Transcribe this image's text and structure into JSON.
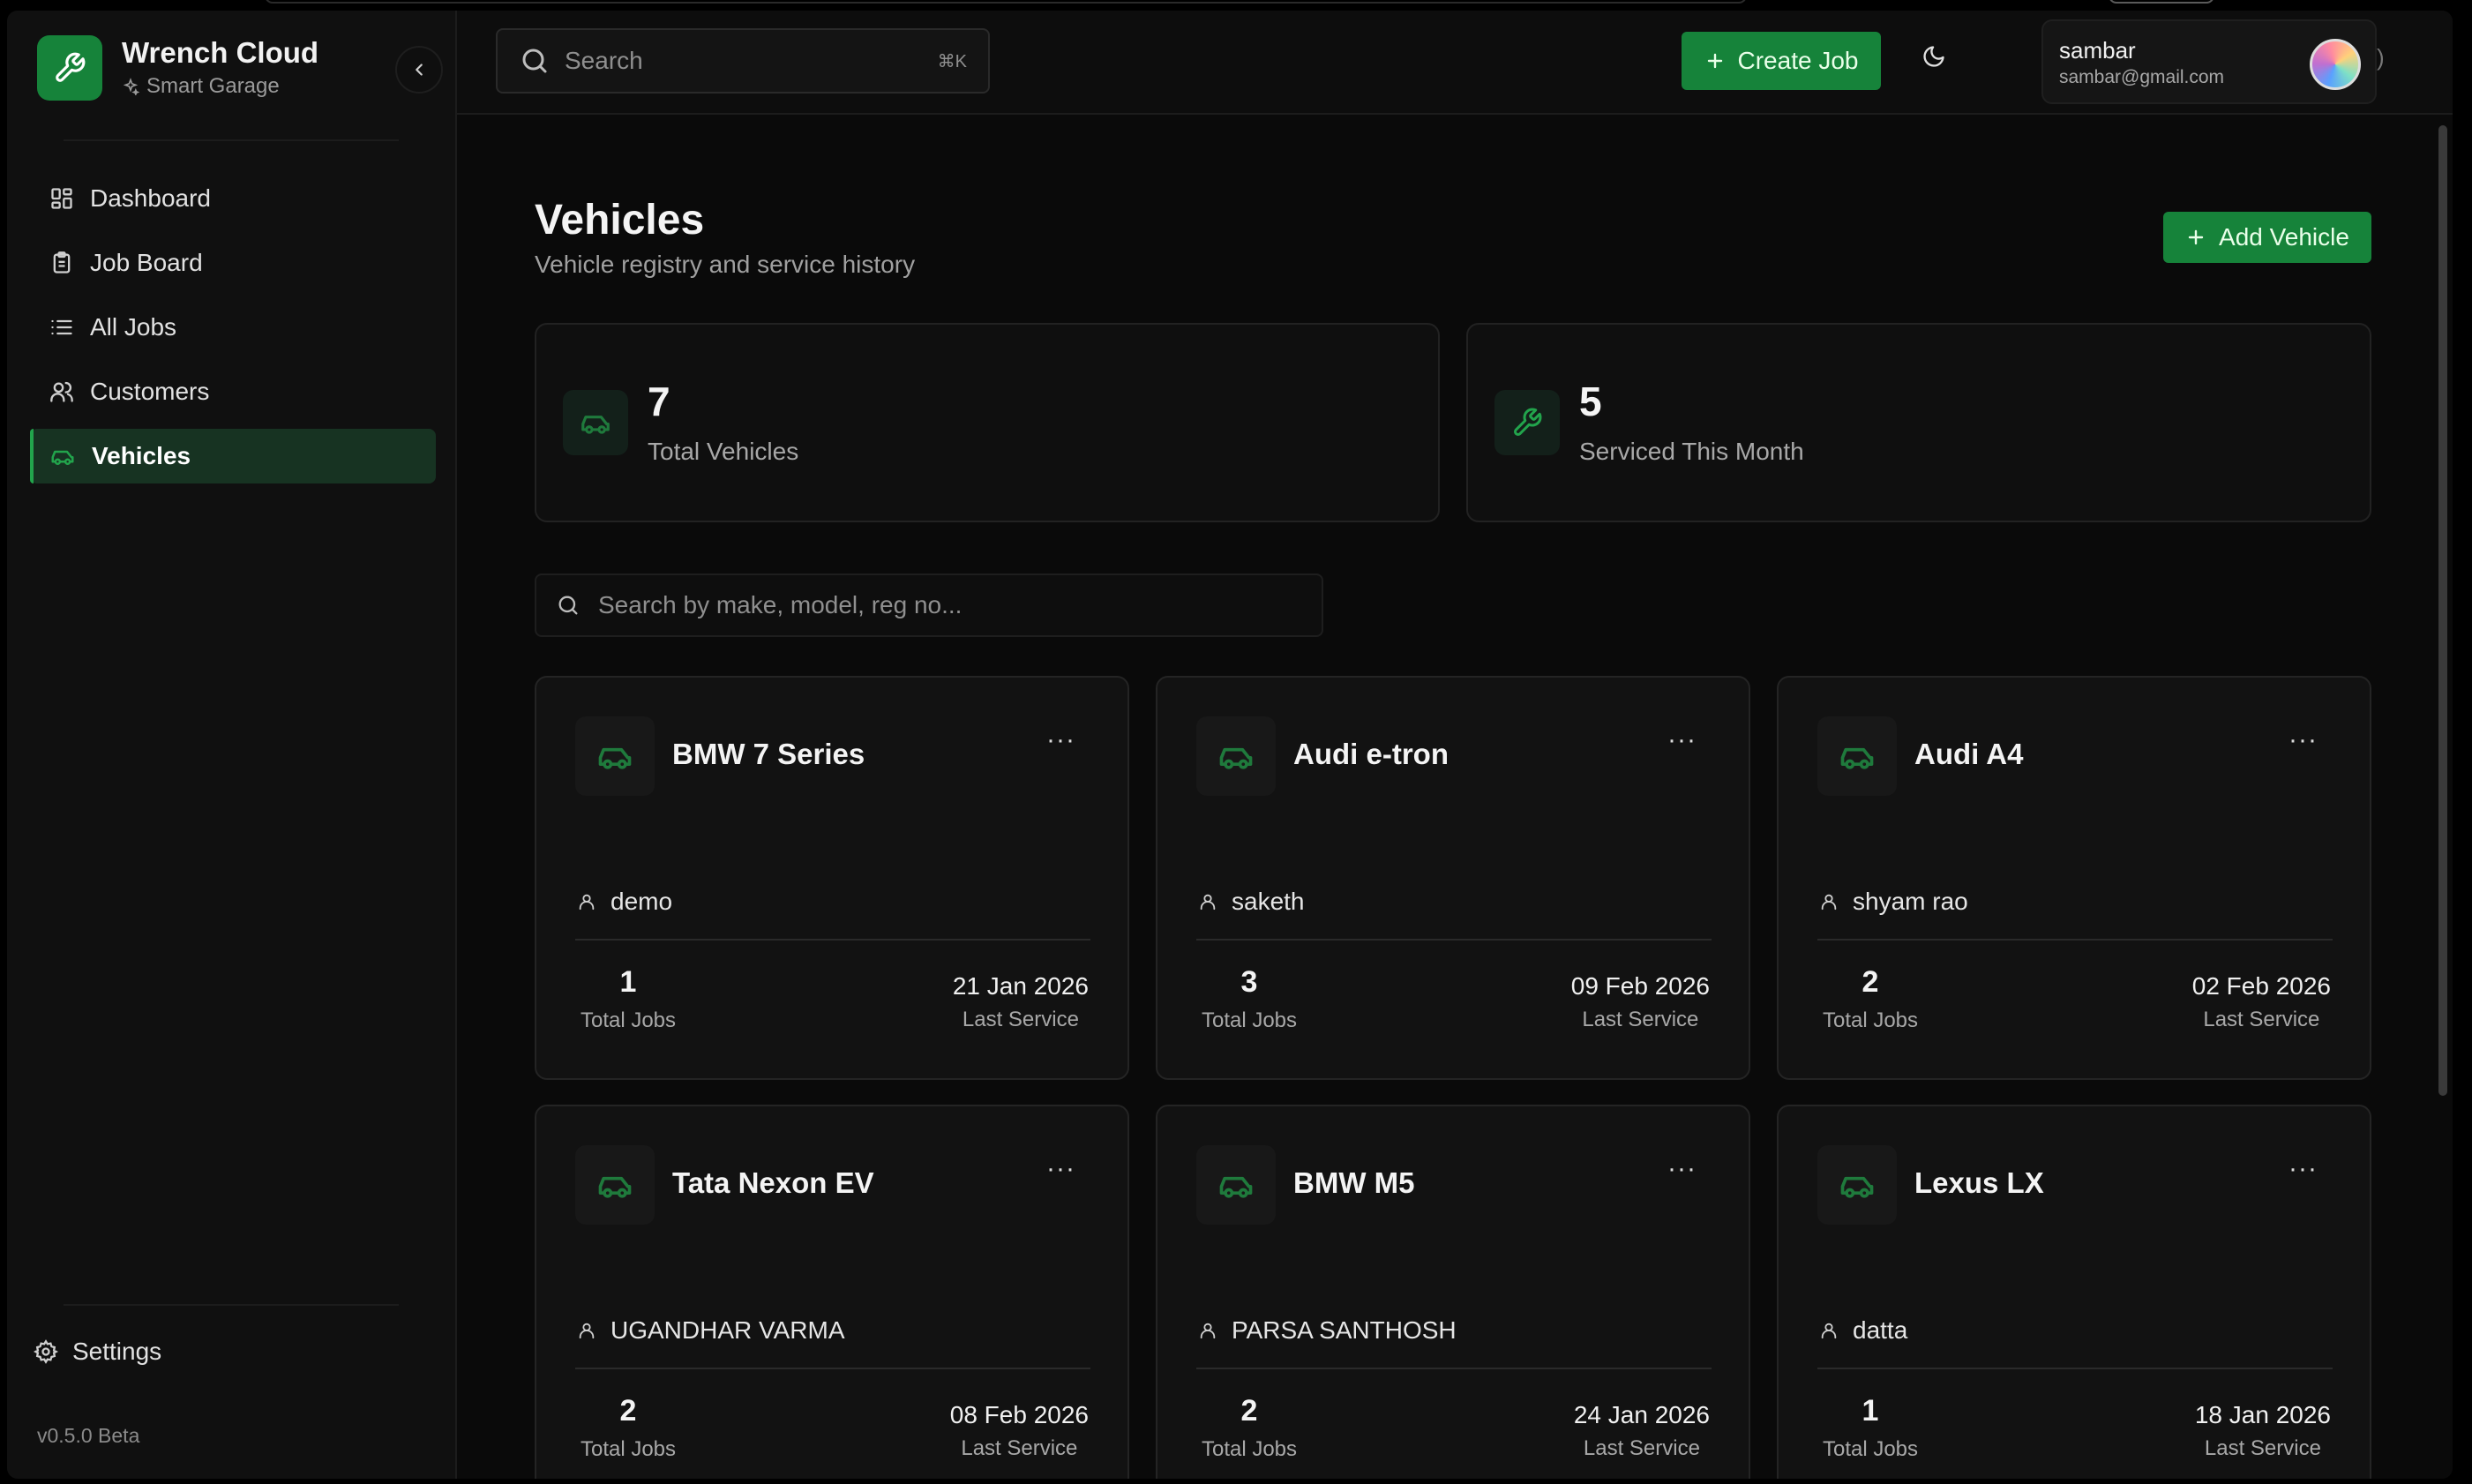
{
  "brand": {
    "title": "Wrench Cloud",
    "subtitle": "Smart Garage"
  },
  "sidebar": {
    "items": [
      {
        "label": "Dashboard",
        "icon": "dashboard-icon"
      },
      {
        "label": "Job Board",
        "icon": "clipboard-icon"
      },
      {
        "label": "All Jobs",
        "icon": "list-icon"
      },
      {
        "label": "Customers",
        "icon": "users-icon"
      },
      {
        "label": "Vehicles",
        "icon": "car-icon",
        "active": true
      }
    ],
    "settings_label": "Settings",
    "version": "v0.5.0 Beta"
  },
  "topbar": {
    "search_placeholder": "Search",
    "search_shortcut": "⌘K",
    "create_job_label": "Create Job",
    "user_name": "sambar",
    "user_email": "sambar@gmail.com"
  },
  "page": {
    "title": "Vehicles",
    "subtitle": "Vehicle registry and service history",
    "add_vehicle_label": "Add Vehicle",
    "vehicle_search_placeholder": "Search by make, model, reg no..."
  },
  "stats": [
    {
      "value": "7",
      "label": "Total Vehicles",
      "icon": "car-icon"
    },
    {
      "value": "5",
      "label": "Serviced This Month",
      "icon": "wrench-icon"
    }
  ],
  "vehicles": [
    {
      "name": "BMW 7 Series",
      "owner": "demo",
      "total_jobs": "1",
      "last_service": "21 Jan 2026"
    },
    {
      "name": "Audi e-tron",
      "owner": "saketh",
      "total_jobs": "3",
      "last_service": "09 Feb 2026"
    },
    {
      "name": "Audi A4",
      "owner": "shyam rao",
      "total_jobs": "2",
      "last_service": "02 Feb 2026"
    },
    {
      "name": "Tata Nexon EV",
      "owner": "UGANDHAR VARMA",
      "total_jobs": "2",
      "last_service": "08 Feb 2026"
    },
    {
      "name": "BMW M5",
      "owner": "PARSA SANTHOSH",
      "total_jobs": "2",
      "last_service": "24 Jan 2026"
    },
    {
      "name": "Lexus LX",
      "owner": "datta",
      "total_jobs": "1",
      "last_service": "18 Jan 2026"
    }
  ],
  "labels": {
    "total_jobs": "Total Jobs",
    "last_service": "Last Service",
    "menu": "···"
  },
  "colors": {
    "accent": "#16833a",
    "accent_icon": "#22a44c",
    "background": "#0a0a0a"
  }
}
